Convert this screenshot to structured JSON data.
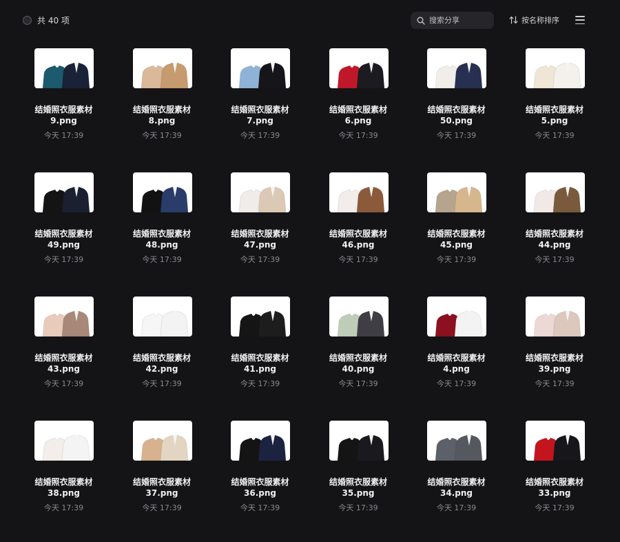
{
  "toolbar": {
    "count_label": "共 40 项",
    "search_placeholder": "搜索分享",
    "sort_label": "按名称排序",
    "icons": {
      "select": "radio-circle-icon",
      "search": "search-icon",
      "sort": "sort-arrows-icon",
      "menu": "hamburger-menu-icon"
    }
  },
  "files": [
    {
      "name": "结婚照衣服素材",
      "ext": "9.png",
      "time": "今天 17:39",
      "left": "#1c5a6e",
      "right": "#1a2238"
    },
    {
      "name": "结婚照衣服素材",
      "ext": "8.png",
      "time": "今天 17:39",
      "left": "#d9b999",
      "right": "#c69b6e"
    },
    {
      "name": "结婚照衣服素材",
      "ext": "7.png",
      "time": "今天 17:39",
      "left": "#8fb3d6",
      "right": "#15151a"
    },
    {
      "name": "结婚照衣服素材",
      "ext": "6.png",
      "time": "今天 17:39",
      "left": "#c01828",
      "right": "#1b1b20"
    },
    {
      "name": "结婚照衣服素材",
      "ext": "50.png",
      "time": "今天 17:39",
      "left": "#f1eeea",
      "right": "#273050"
    },
    {
      "name": "结婚照衣服素材",
      "ext": "5.png",
      "time": "今天 17:39",
      "left": "#efe6d6",
      "right": "#f4f1ec"
    },
    {
      "name": "结婚照衣服素材",
      "ext": "49.png",
      "time": "今天 17:39",
      "left": "#141414",
      "right": "#1a2030"
    },
    {
      "name": "结婚照衣服素材",
      "ext": "48.png",
      "time": "今天 17:39",
      "left": "#121212",
      "right": "#2a3c6a"
    },
    {
      "name": "结婚照衣服素材",
      "ext": "47.png",
      "time": "今天 17:39",
      "left": "#efece9",
      "right": "#dcc9b5"
    },
    {
      "name": "结婚照衣服素材",
      "ext": "46.png",
      "time": "今天 17:39",
      "left": "#f2ecea",
      "right": "#8a5a3a"
    },
    {
      "name": "结婚照衣服素材",
      "ext": "45.png",
      "time": "今天 17:39",
      "left": "#b7a48e",
      "right": "#d6b68c"
    },
    {
      "name": "结婚照衣服素材",
      "ext": "44.png",
      "time": "今天 17:39",
      "left": "#f1e9e6",
      "right": "#7a5a3c"
    },
    {
      "name": "结婚照衣服素材",
      "ext": "43.png",
      "time": "今天 17:39",
      "left": "#e8cbbb",
      "right": "#a88878"
    },
    {
      "name": "结婚照衣服素材",
      "ext": "42.png",
      "time": "今天 17:39",
      "left": "#f6f6f6",
      "right": "#f3f3f3"
    },
    {
      "name": "结婚照衣服素材",
      "ext": "41.png",
      "time": "今天 17:39",
      "left": "#151515",
      "right": "#1d1d1d"
    },
    {
      "name": "结婚照衣服素材",
      "ext": "40.png",
      "time": "今天 17:39",
      "left": "#bfcdb8",
      "right": "#3e3e44"
    },
    {
      "name": "结婚照衣服素材",
      "ext": "4.png",
      "time": "今天 17:39",
      "left": "#8c1020",
      "right": "#f3f3f3"
    },
    {
      "name": "结婚照衣服素材",
      "ext": "39.png",
      "time": "今天 17:39",
      "left": "#ecd9d6",
      "right": "#dcc8bc"
    },
    {
      "name": "结婚照衣服素材",
      "ext": "38.png",
      "time": "今天 17:39",
      "left": "#f4eeea",
      "right": "#f4f4f4"
    },
    {
      "name": "结婚照衣服素材",
      "ext": "37.png",
      "time": "今天 17:39",
      "left": "#d8b28e",
      "right": "#e2d6c2"
    },
    {
      "name": "结婚照衣服素材",
      "ext": "36.png",
      "time": "今天 17:39",
      "left": "#141414",
      "right": "#1b2340"
    },
    {
      "name": "结婚照衣服素材",
      "ext": "35.png",
      "time": "今天 17:39",
      "left": "#141414",
      "right": "#1a1a1e"
    },
    {
      "name": "结婚照衣服素材",
      "ext": "34.png",
      "time": "今天 17:39",
      "left": "#5c6068",
      "right": "#55585e"
    },
    {
      "name": "结婚照衣服素材",
      "ext": "33.png",
      "time": "今天 17:39",
      "left": "#c4141e",
      "right": "#17171b"
    }
  ]
}
